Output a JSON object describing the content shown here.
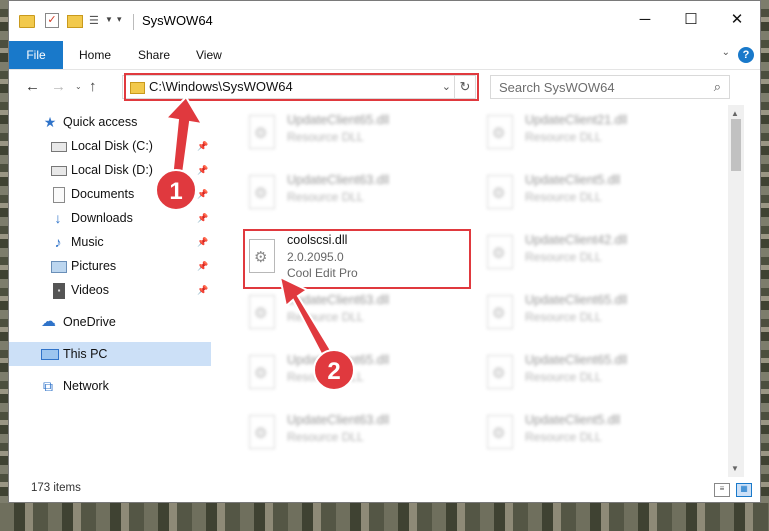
{
  "window": {
    "title": "SysWOW64",
    "controls": {
      "minimize": "─",
      "maximize": "☐",
      "close": "✕"
    }
  },
  "ribbon": {
    "tabs": [
      {
        "label": "File"
      },
      {
        "label": "Home"
      },
      {
        "label": "Share"
      },
      {
        "label": "View"
      }
    ],
    "expand_glyph": "⌄",
    "help_glyph": "?"
  },
  "navigation": {
    "back": "←",
    "forward": "→",
    "recent": "⌄",
    "up": "↑",
    "address": "C:\\Windows\\SysWOW64",
    "address_dropdown": "⌄",
    "refresh": "↻",
    "search_placeholder": "Search SysWOW64",
    "search_glyph": "⌕"
  },
  "sidebar": {
    "items": [
      {
        "label": "Quick access",
        "icon": "star-icon",
        "glyph": "★",
        "pinned": false
      },
      {
        "label": "Local Disk (C:)",
        "icon": "drive-icon",
        "glyph": "",
        "pinned": true
      },
      {
        "label": "Local Disk (D:)",
        "icon": "drive-icon",
        "glyph": "",
        "pinned": true
      },
      {
        "label": "Documents",
        "icon": "documents-icon",
        "glyph": "",
        "pinned": true
      },
      {
        "label": "Downloads",
        "icon": "downloads-icon",
        "glyph": "↓",
        "pinned": true
      },
      {
        "label": "Music",
        "icon": "music-icon",
        "glyph": "♪",
        "pinned": true
      },
      {
        "label": "Pictures",
        "icon": "pictures-icon",
        "glyph": "",
        "pinned": true
      },
      {
        "label": "Videos",
        "icon": "videos-icon",
        "glyph": "▪",
        "pinned": true
      },
      {
        "label": "OneDrive",
        "icon": "onedrive-icon",
        "glyph": "☁"
      },
      {
        "label": "This PC",
        "icon": "computer-icon",
        "glyph": "",
        "selected": true
      },
      {
        "label": "Network",
        "icon": "network-icon",
        "glyph": "⧉"
      }
    ],
    "pin_glyph": "📌"
  },
  "files": {
    "left_column": [
      {
        "name": "UpdateClient65.dll",
        "type": "Resource DLL"
      },
      {
        "name": "UpdateClient63.dll",
        "type": "Resource DLL"
      },
      {
        "name": "coolscsi.dll",
        "version": "2.0.2095.0",
        "type": "Cool Edit Pro",
        "highlighted": true
      },
      {
        "name": "UpdateClient63.dll",
        "type": "Resource DLL"
      },
      {
        "name": "UpdateClient65.dll",
        "type": "Resource DLL"
      },
      {
        "name": "UpdateClient63.dll",
        "type": "Resource DLL"
      }
    ],
    "right_column": [
      {
        "name": "UpdateClient21.dll",
        "type": "Resource DLL"
      },
      {
        "name": "UpdateClient5.dll",
        "type": "Resource DLL"
      },
      {
        "name": "UpdateClient42.dll",
        "type": "Resource DLL"
      },
      {
        "name": "UpdateClient65.dll",
        "type": "Resource DLL"
      },
      {
        "name": "UpdateClient65.dll",
        "type": "Resource DLL"
      },
      {
        "name": "UpdateClient5.dll",
        "type": "Resource DLL"
      }
    ],
    "gear_glyph": "⚙"
  },
  "status": {
    "item_count": "173 items",
    "view_details_glyph": "≡",
    "view_tiles_glyph": "▦"
  },
  "annotations": {
    "step1": "1",
    "step2": "2",
    "accent_color": "#e0393e"
  },
  "colors": {
    "ribbon_file_tab": "#1979ca",
    "selection": "#cce0f7"
  }
}
